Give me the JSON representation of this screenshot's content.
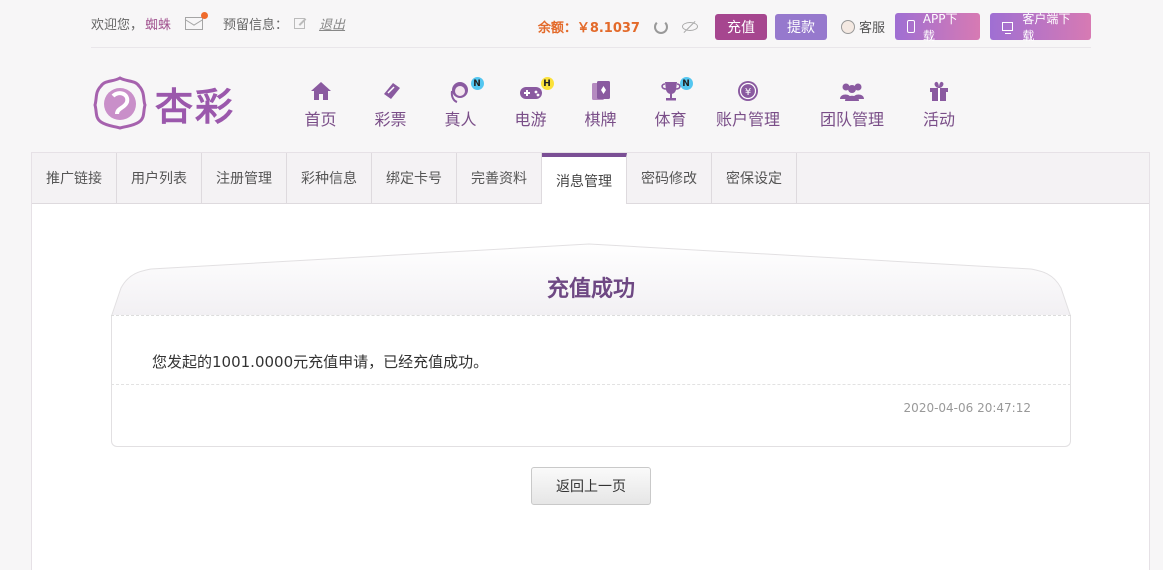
{
  "topbar": {
    "welcome": "欢迎您，",
    "username": "蜘蛛",
    "reserve_label": "预留信息：",
    "logout": "退出",
    "balance": "余额：￥8.1037",
    "recharge": "充值",
    "withdraw": "提款",
    "service": "客服",
    "app_download": "APP下载",
    "client_download": "客户端下载"
  },
  "logo": {
    "text": "杏彩",
    "color": "#9b58ac"
  },
  "nav": [
    {
      "label": "首页",
      "icon": "home-icon",
      "badge": ""
    },
    {
      "label": "彩票",
      "icon": "ticket-icon",
      "badge": ""
    },
    {
      "label": "真人",
      "icon": "dealer-icon",
      "badge": "N"
    },
    {
      "label": "电游",
      "icon": "gamepad-icon",
      "badge": "H"
    },
    {
      "label": "棋牌",
      "icon": "cards-icon",
      "badge": ""
    },
    {
      "label": "体育",
      "icon": "trophy-icon",
      "badge": "N"
    },
    {
      "label": "账户管理",
      "icon": "yuan-coin-icon",
      "badge": ""
    },
    {
      "label": "团队管理",
      "icon": "team-icon",
      "badge": ""
    },
    {
      "label": "活动",
      "icon": "gift-icon",
      "badge": ""
    }
  ],
  "tabs": [
    {
      "label": "推广链接"
    },
    {
      "label": "用户列表"
    },
    {
      "label": "注册管理"
    },
    {
      "label": "彩种信息"
    },
    {
      "label": "绑定卡号"
    },
    {
      "label": "完善资料"
    },
    {
      "label": "消息管理",
      "active": true
    },
    {
      "label": "密码修改"
    },
    {
      "label": "密保设定"
    }
  ],
  "message": {
    "title": "充值成功",
    "content": "您发起的1001.0000元充值申请，已经充值成功。",
    "time": "2020-04-06 20:47:12"
  },
  "back_button": "返回上一页",
  "colors": {
    "accent": "#7b4f95",
    "recharge": "#a6468f",
    "withdraw": "#9679cd",
    "balance": "#e36a2a"
  }
}
